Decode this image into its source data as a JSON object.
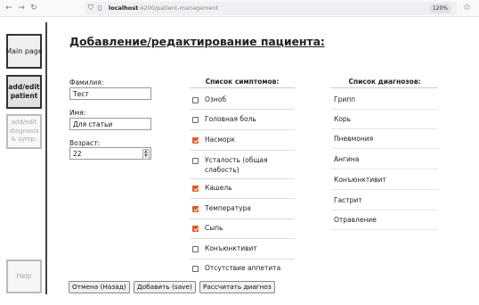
{
  "browser": {
    "url_host": "localhost",
    "url_path": ":4200/patient-management",
    "zoom": "120%"
  },
  "sidebar": {
    "main_page": "Main page",
    "add_edit_patient": "add/edit patient",
    "add_edit_diagnosis": "add/edit diagnosis & symp.",
    "help": "Help"
  },
  "page": {
    "title": "Добавление/редактирование пациента:"
  },
  "form": {
    "surname_label": "Фамилия:",
    "surname_value": "Тест",
    "name_label": "Имя:",
    "name_value": "Для статьи",
    "age_label": "Возраст:",
    "age_value": "22"
  },
  "symptoms": {
    "header": "Список симптомов:",
    "items": [
      {
        "label": "Озноб",
        "checked": false
      },
      {
        "label": "Головная боль",
        "checked": false
      },
      {
        "label": "Насморк",
        "checked": true
      },
      {
        "label": "Усталость (общая слабость)",
        "checked": false
      },
      {
        "label": "Кашель",
        "checked": true
      },
      {
        "label": "Температура",
        "checked": true
      },
      {
        "label": "Сыпь",
        "checked": true
      },
      {
        "label": "Конъюнктивит",
        "checked": false
      },
      {
        "label": "Отсутствие аппетита",
        "checked": false
      }
    ]
  },
  "diagnoses": {
    "header": "Список диагнозов:",
    "items": [
      "Грипп",
      "Корь",
      "Пневмония",
      "Ангина",
      "Конъюнктивит",
      "Гастрит",
      "Отравление"
    ]
  },
  "buttons": {
    "cancel": "Отмена (Назад)",
    "add": "Добавить (save)",
    "calculate": "Рассчитать диагноз"
  },
  "colors": {
    "checkbox_checked": "#e05a28"
  }
}
